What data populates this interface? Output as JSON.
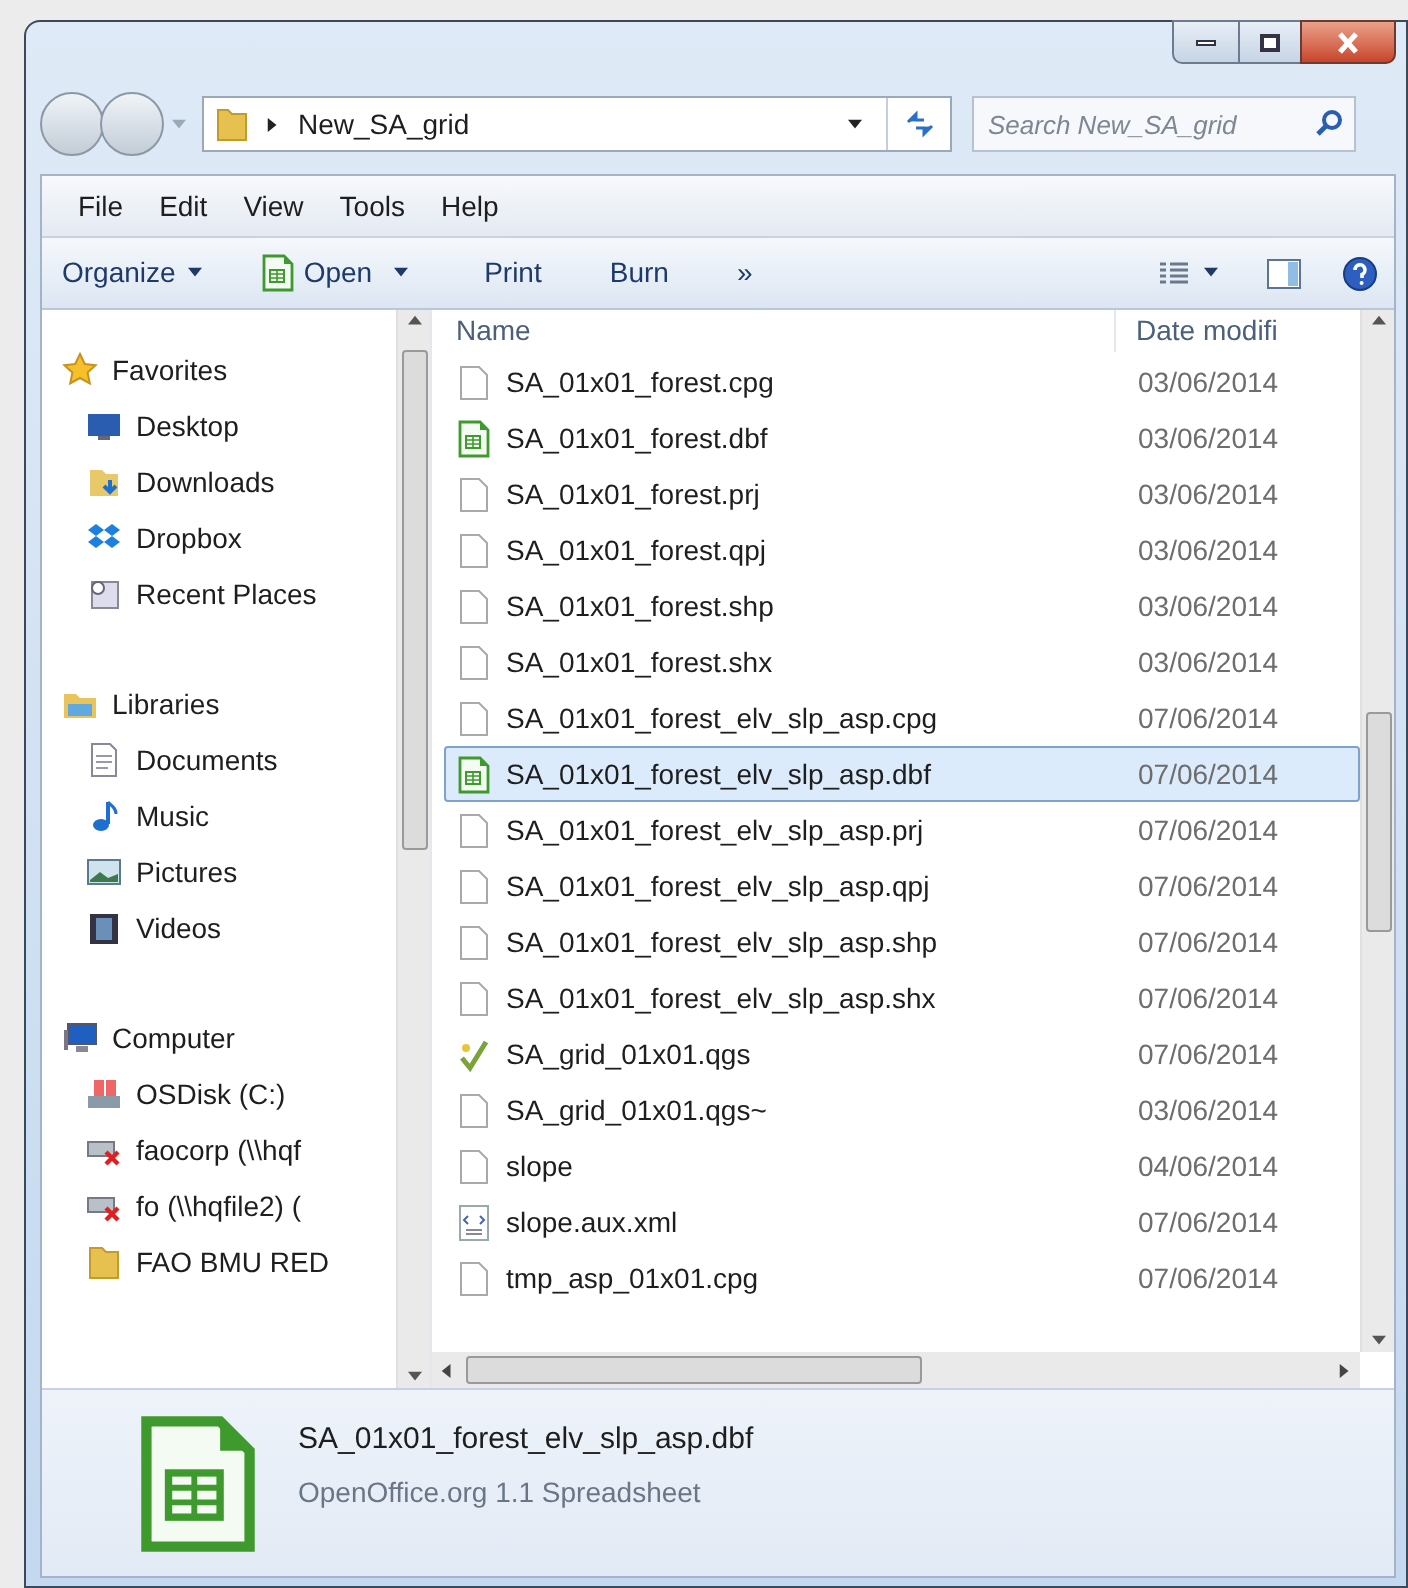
{
  "address": {
    "crumbs": [
      "New_SA_grid"
    ]
  },
  "search": {
    "placeholder": "Search New_SA_grid"
  },
  "menu": [
    "File",
    "Edit",
    "View",
    "Tools",
    "Help"
  ],
  "toolbar": [
    {
      "label": "Organize",
      "kind": "dropdown"
    },
    {
      "label": "Open",
      "kind": "open"
    },
    {
      "label": "Print",
      "kind": "plain"
    },
    {
      "label": "Burn",
      "kind": "plain"
    },
    {
      "label": "»",
      "kind": "plain"
    }
  ],
  "navigation": [
    {
      "label": "Favorites",
      "children": [
        {
          "label": "Desktop"
        },
        {
          "label": "Downloads"
        },
        {
          "label": "Dropbox"
        },
        {
          "label": "Recent Places"
        }
      ]
    },
    {
      "label": "Libraries",
      "children": [
        {
          "label": "Documents"
        },
        {
          "label": "Music"
        },
        {
          "label": "Pictures"
        },
        {
          "label": "Videos"
        }
      ]
    },
    {
      "label": "Computer",
      "children": [
        {
          "label": "OSDisk (C:)"
        },
        {
          "label": "faocorp (\\\\hqf"
        },
        {
          "label": "fo (\\\\hqfile2) ("
        },
        {
          "label": "FAO BMU RED"
        }
      ]
    }
  ],
  "columns": [
    "Name",
    "Date modifi"
  ],
  "files": [
    {
      "name": "SA_01x01_forest.cpg",
      "date": "03/06/2014",
      "kind": "file",
      "selected": false
    },
    {
      "name": "SA_01x01_forest.dbf",
      "date": "03/06/2014",
      "kind": "spreadsheet",
      "selected": false
    },
    {
      "name": "SA_01x01_forest.prj",
      "date": "03/06/2014",
      "kind": "file",
      "selected": false
    },
    {
      "name": "SA_01x01_forest.qpj",
      "date": "03/06/2014",
      "kind": "file",
      "selected": false
    },
    {
      "name": "SA_01x01_forest.shp",
      "date": "03/06/2014",
      "kind": "file",
      "selected": false
    },
    {
      "name": "SA_01x01_forest.shx",
      "date": "03/06/2014",
      "kind": "file",
      "selected": false
    },
    {
      "name": "SA_01x01_forest_elv_slp_asp.cpg",
      "date": "07/06/2014",
      "kind": "file",
      "selected": false
    },
    {
      "name": "SA_01x01_forest_elv_slp_asp.dbf",
      "date": "07/06/2014",
      "kind": "spreadsheet",
      "selected": true
    },
    {
      "name": "SA_01x01_forest_elv_slp_asp.prj",
      "date": "07/06/2014",
      "kind": "file",
      "selected": false
    },
    {
      "name": "SA_01x01_forest_elv_slp_asp.qpj",
      "date": "07/06/2014",
      "kind": "file",
      "selected": false
    },
    {
      "name": "SA_01x01_forest_elv_slp_asp.shp",
      "date": "07/06/2014",
      "kind": "file",
      "selected": false
    },
    {
      "name": "SA_01x01_forest_elv_slp_asp.shx",
      "date": "07/06/2014",
      "kind": "file",
      "selected": false
    },
    {
      "name": "SA_grid_01x01.qgs",
      "date": "07/06/2014",
      "kind": "qgis",
      "selected": false
    },
    {
      "name": "SA_grid_01x01.qgs~",
      "date": "03/06/2014",
      "kind": "file",
      "selected": false
    },
    {
      "name": "slope",
      "date": "04/06/2014",
      "kind": "file",
      "selected": false
    },
    {
      "name": "slope.aux.xml",
      "date": "07/06/2014",
      "kind": "xml",
      "selected": false
    },
    {
      "name": "tmp_asp_01x01.cpg",
      "date": "07/06/2014",
      "kind": "file",
      "selected": false
    }
  ],
  "details": {
    "name": "SA_01x01_forest_elv_slp_asp.dbf",
    "type": "OpenOffice.org 1.1 Spreadsheet"
  }
}
